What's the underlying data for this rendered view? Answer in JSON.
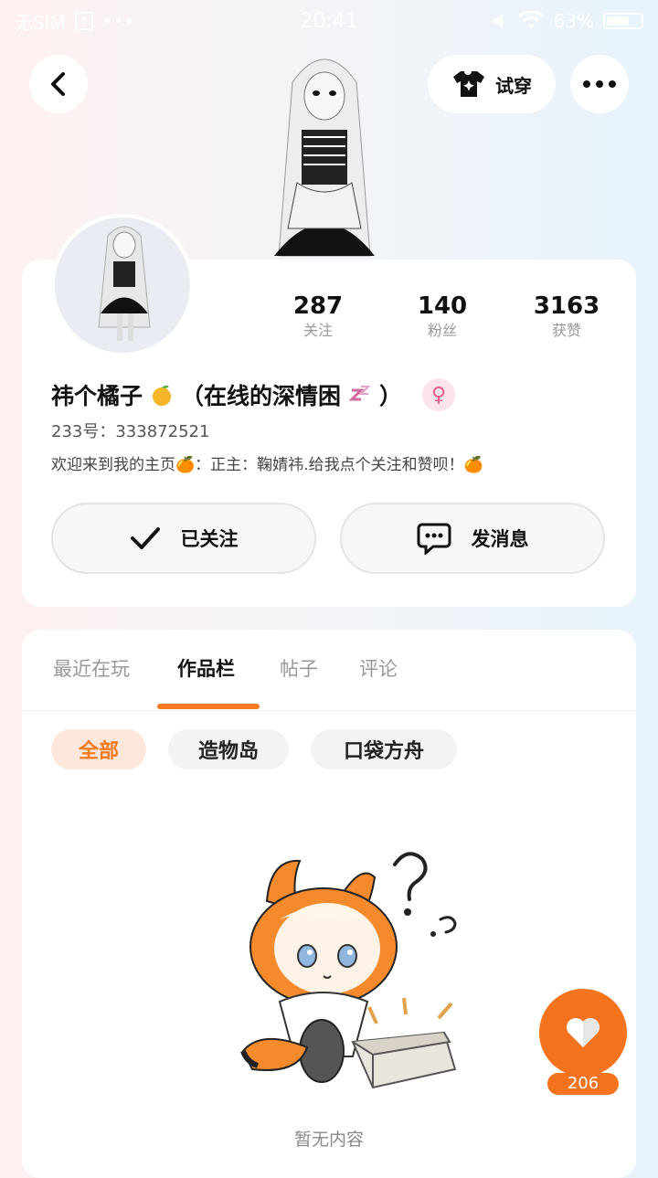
{
  "status_bar": {
    "sim": "无SIM",
    "sim_badge": "↑",
    "dots": "•••",
    "time": "20:41",
    "battery": "63%"
  },
  "header": {
    "tryon_label": "试穿",
    "icons": [
      "back-arrow-icon",
      "tshirt-sparkle-icon",
      "more-icon"
    ]
  },
  "profile": {
    "stats": [
      {
        "value": "287",
        "label": "关注"
      },
      {
        "value": "140",
        "label": "粉丝"
      },
      {
        "value": "3163",
        "label": "获赞"
      }
    ],
    "nickname_prefix": "祎个橘子",
    "nickname_mid": "（在线的深情困",
    "nickname_suffix": "）",
    "gender_symbol": "♀",
    "uid": "233号：333872521",
    "bio": "欢迎来到我的主页🍊：正主：鞠婧祎.给我点个关注和赞呗！🍊",
    "follow_label": "已关注",
    "message_label": "发消息"
  },
  "tabs": [
    {
      "label": "最近在玩",
      "active": false
    },
    {
      "label": "作品栏",
      "active": true
    },
    {
      "label": "帖子",
      "active": false
    },
    {
      "label": "评论",
      "active": false
    }
  ],
  "chips": [
    {
      "label": "全部",
      "active": true
    },
    {
      "label": "造物岛",
      "active": false
    },
    {
      "label": "口袋方舟",
      "active": false
    }
  ],
  "empty_state": {
    "text": "暂无内容"
  },
  "like": {
    "count": "206"
  },
  "colors": {
    "accent": "#f57a1f",
    "gender": "#e85a87"
  }
}
